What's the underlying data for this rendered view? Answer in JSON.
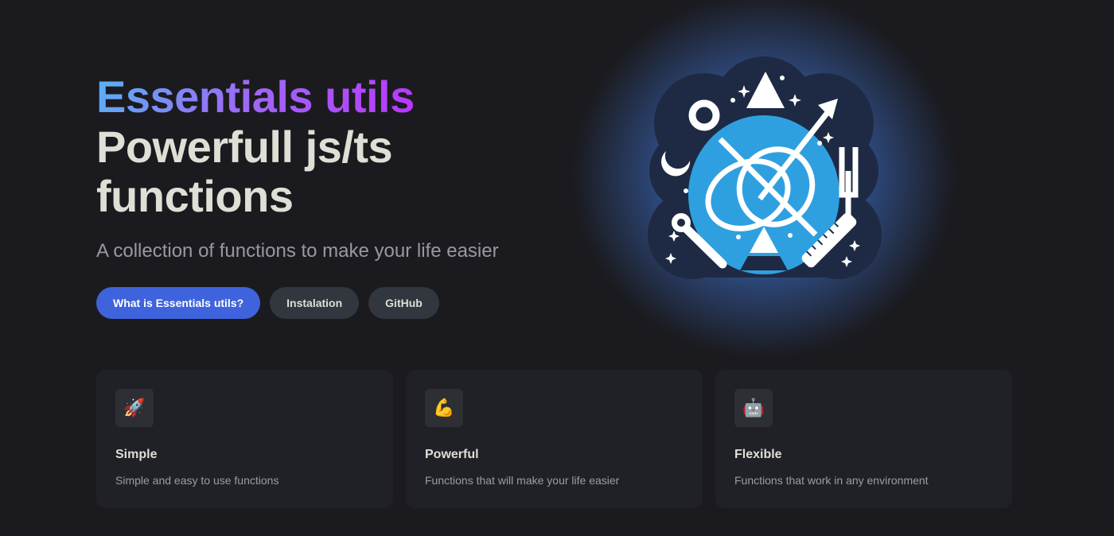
{
  "hero": {
    "name": "Essentials utils",
    "headline": "Powerfull js/ts functions",
    "tagline": "A collection of functions to make your life easier",
    "logo_icon": "utility-tools-logo-icon"
  },
  "actions": [
    {
      "label": "What is Essentials utils?",
      "theme": "brand"
    },
    {
      "label": "Instalation",
      "theme": "alt"
    },
    {
      "label": "GitHub",
      "theme": "alt"
    }
  ],
  "features": [
    {
      "icon": "🚀",
      "icon_name": "rocket-icon",
      "title": "Simple",
      "details": "Simple and easy to use functions"
    },
    {
      "icon": "💪",
      "icon_name": "flexed-biceps-icon",
      "title": "Powerful",
      "details": "Functions that will make your life easier"
    },
    {
      "icon": "🤖",
      "icon_name": "robot-icon",
      "title": "Flexible",
      "details": "Functions that work in any environment"
    }
  ],
  "colors": {
    "background": "#1b1b1f",
    "brand": "#3e63dd",
    "gradient_start": "#56b4f5",
    "gradient_end": "#bd34fe",
    "card": "#202127"
  }
}
